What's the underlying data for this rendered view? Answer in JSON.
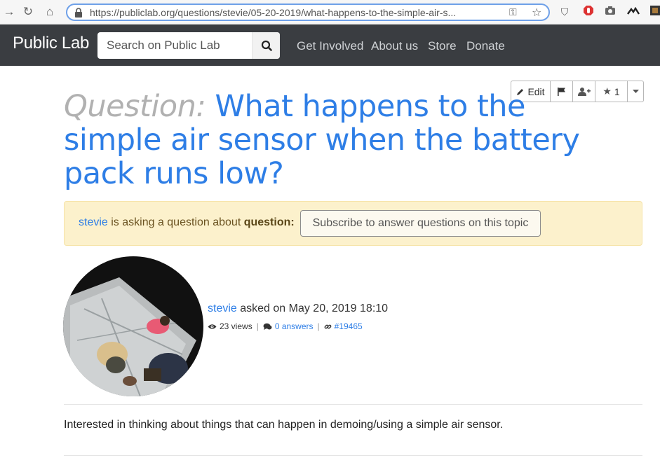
{
  "browser": {
    "url": "https://publiclab.org/questions/stevie/05-20-2019/what-happens-to-the-simple-air-s..."
  },
  "header": {
    "brand": "Public Lab",
    "search_placeholder": "Search on Public Lab",
    "nav": [
      "Get Involved",
      "About us",
      "Store",
      "Donate"
    ]
  },
  "toolbar": {
    "edit_label": "Edit",
    "star_count": "1"
  },
  "question": {
    "label": "Question:",
    "title": " What happens to the simple air sensor when the battery pack runs low?"
  },
  "alert": {
    "user": "stevie",
    "text_middle": " is asking a question about ",
    "topic": "question:",
    "subscribe_label": "Subscribe to answer questions on this topic"
  },
  "author": {
    "name": "stevie",
    "asked_text": " asked on May 20, 2019 18:10",
    "views": "23 views",
    "answers": "0 answers",
    "node_id": "#19465"
  },
  "body": {
    "text": "Interested in thinking about things that can happen in demoing/using a simple air sensor."
  },
  "colors": {
    "accent": "#2e7ee6",
    "header_bg": "#3a3d41",
    "alert_bg": "#fcf1cc"
  }
}
